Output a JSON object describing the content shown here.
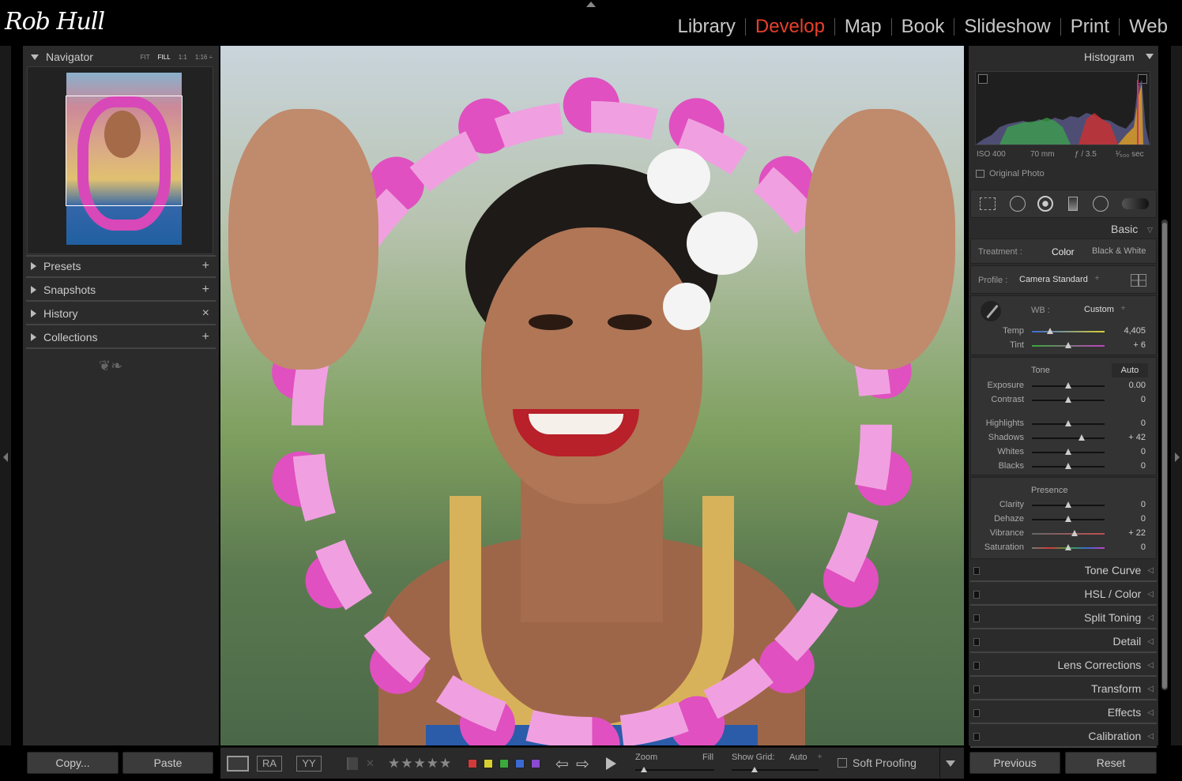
{
  "app": {
    "logo": "Rob Hull",
    "modules": [
      "Library",
      "Develop",
      "Map",
      "Book",
      "Slideshow",
      "Print",
      "Web"
    ],
    "active_module": "Develop",
    "accent": "#e8402c"
  },
  "left_panel": {
    "navigator": {
      "title": "Navigator",
      "zoom_options": [
        "FIT",
        "FILL",
        "1:1",
        "1:16 ÷"
      ],
      "selected_zoom": "FILL"
    },
    "panels": [
      {
        "title": "Presets",
        "action": "+"
      },
      {
        "title": "Snapshots",
        "action": "+"
      },
      {
        "title": "History",
        "action": "×"
      },
      {
        "title": "Collections",
        "action": "+"
      }
    ],
    "copy_label": "Copy...",
    "paste_label": "Paste"
  },
  "toolbar": {
    "zoom_label": "Zoom",
    "zoom_value": "Fill",
    "grid_label": "Show Grid:",
    "grid_value": "Auto",
    "soft_proofing": "Soft Proofing",
    "label_colors": [
      "#d23a3a",
      "#d8d030",
      "#3aa83a",
      "#3a6ad2",
      "#8a4ad2"
    ]
  },
  "right_panel": {
    "histogram": {
      "title": "Histogram",
      "iso": "ISO 400",
      "focal": "70 mm",
      "aperture": "ƒ / 3.5",
      "shutter": "¹⁄₅₀₀ sec",
      "original_photo": "Original Photo"
    },
    "basic": {
      "title": "Basic",
      "treatment_label": "Treatment :",
      "treatment_color": "Color",
      "treatment_bw": "Black & White",
      "profile_label": "Profile :",
      "profile_value": "Camera Standard",
      "wb_label": "WB :",
      "wb_value": "Custom",
      "tone_label": "Tone",
      "auto_label": "Auto",
      "presence_label": "Presence",
      "sliders": [
        {
          "name": "Temp",
          "value": "4,405",
          "pos": 0.25
        },
        {
          "name": "Tint",
          "value": "+ 6",
          "pos": 0.5
        },
        {
          "name": "Exposure",
          "value": "0.00",
          "pos": 0.5
        },
        {
          "name": "Contrast",
          "value": "0",
          "pos": 0.5
        },
        {
          "name": "Highlights",
          "value": "0",
          "pos": 0.5
        },
        {
          "name": "Shadows",
          "value": "+ 42",
          "pos": 0.68
        },
        {
          "name": "Whites",
          "value": "0",
          "pos": 0.5
        },
        {
          "name": "Blacks",
          "value": "0",
          "pos": 0.5
        },
        {
          "name": "Clarity",
          "value": "0",
          "pos": 0.5
        },
        {
          "name": "Dehaze",
          "value": "0",
          "pos": 0.5
        },
        {
          "name": "Vibrance",
          "value": "+ 22",
          "pos": 0.59
        },
        {
          "name": "Saturation",
          "value": "0",
          "pos": 0.5
        }
      ]
    },
    "sections": [
      "Tone Curve",
      "HSL / Color",
      "Split Toning",
      "Detail",
      "Lens Corrections",
      "Transform",
      "Effects",
      "Calibration"
    ],
    "previous_label": "Previous",
    "reset_label": "Reset"
  }
}
